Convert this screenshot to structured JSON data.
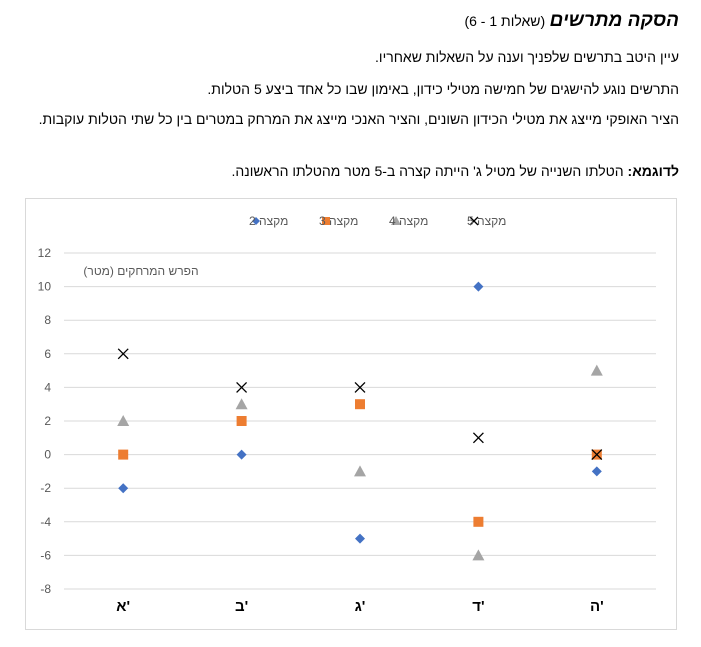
{
  "heading": {
    "title": "הסקה מתרשים",
    "subtitle": "(שאלות 1 - 6)"
  },
  "paragraphs": {
    "p1": "עיין היטב בתרשים שלפניך וענה על השאלות שאחריו.",
    "p2": "התרשים נוגע להישגים של חמישה מטילי כידון, באימון שבו כל אחד ביצע 5 הטלות.",
    "p3": "הציר האופקי מייצג את מטילי הכידון השונים, והציר האנכי  מייצג את המרחק במטרים בין כל שתי הטלות עוקבות.",
    "example_label": "לדוגמא:",
    "example_text": " הטלתו השנייה של מטיל ג' הייתה קצרה ב-5 מטר מהטלתו הראשונה."
  },
  "colors": {
    "series_2": "#4472c4",
    "series_3": "#ed7d31",
    "series_4": "#a5a5a5",
    "series_5": "#000000",
    "gridline": "#d9d9d9",
    "axis_text": "#595959"
  },
  "chart_data": {
    "type": "scatter",
    "categories": [
      "א'",
      "ב'",
      "ג'",
      "ד'",
      "ה'"
    ],
    "ylabel": "הפרש המרחקים (מטר)",
    "xlabel": "",
    "ylim": [
      -8,
      12
    ],
    "yticks": [
      -8,
      -6,
      -4,
      -2,
      0,
      2,
      4,
      6,
      8,
      10,
      12
    ],
    "grid": true,
    "legend_position": "top",
    "series": [
      {
        "name": "מקצה 2",
        "marker": "diamond",
        "values": [
          -2,
          0,
          -5,
          10,
          -1
        ]
      },
      {
        "name": "מקצה 3",
        "marker": "square",
        "values": [
          0,
          2,
          3,
          -4,
          0
        ]
      },
      {
        "name": "מקצה 4",
        "marker": "triangle",
        "values": [
          2,
          3,
          -1,
          -6,
          5
        ]
      },
      {
        "name": "מקצה 5",
        "marker": "x",
        "values": [
          6,
          4,
          4,
          1,
          0
        ]
      }
    ]
  }
}
